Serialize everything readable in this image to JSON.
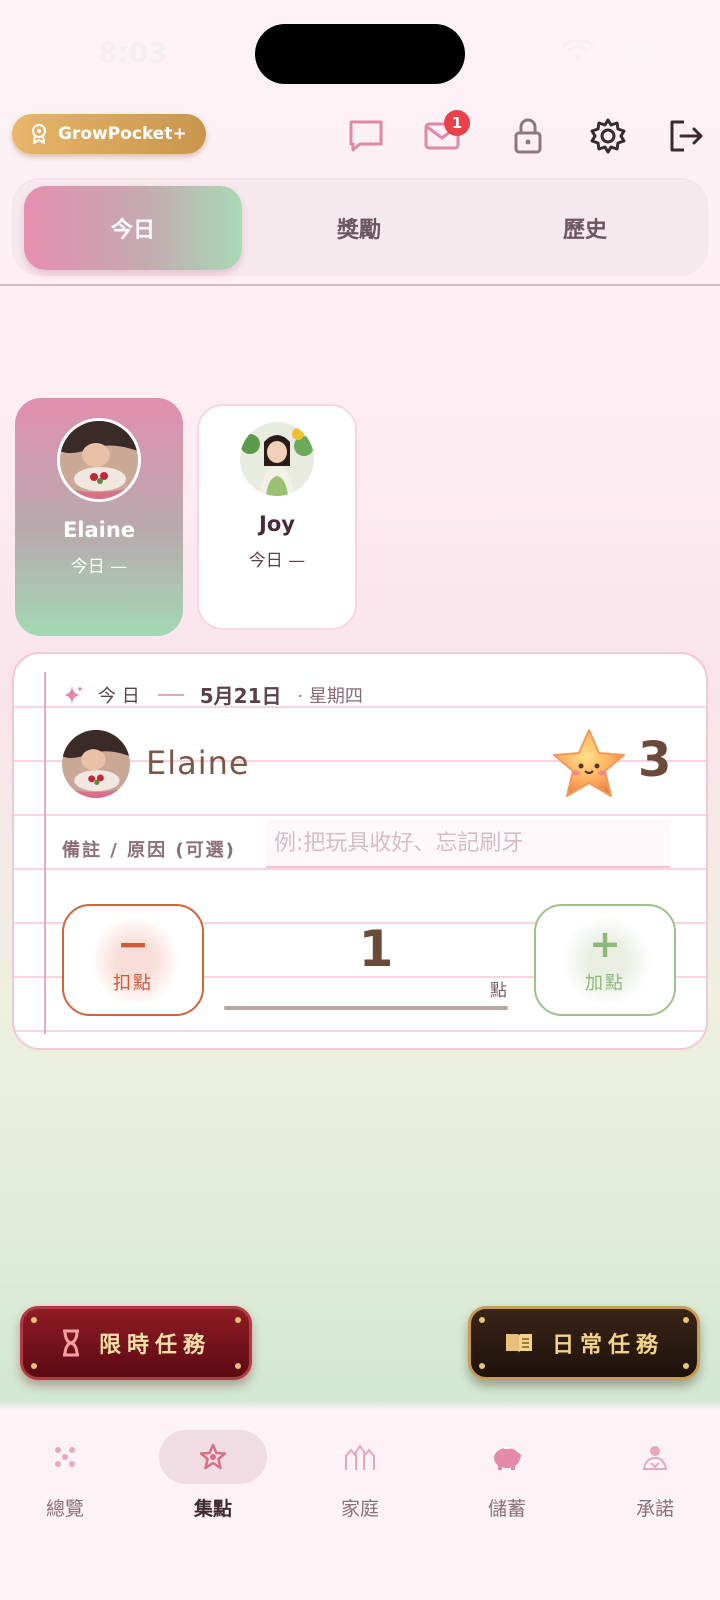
{
  "status_bar": {
    "time": "8:03"
  },
  "header": {
    "pro_badge_label": "GrowPocket+",
    "mail_badge_count": "1",
    "icons": [
      "chat-icon",
      "mail-icon",
      "lock-icon",
      "gear-icon",
      "logout-icon"
    ]
  },
  "tabs": [
    {
      "label": "今日",
      "active": true
    },
    {
      "label": "獎勵",
      "active": false
    },
    {
      "label": "歷史",
      "active": false
    }
  ],
  "kids": [
    {
      "name": "Elaine",
      "today": "今日 —",
      "selected": true
    },
    {
      "name": "Joy",
      "today": "今日 —",
      "selected": false
    }
  ],
  "entry": {
    "today_label": "今 日",
    "date": "5月21日",
    "weekday": "· 星期四",
    "kid_name": "Elaine",
    "star_count": "3",
    "reason_label": "備註 / 原因 (可選)",
    "reason_placeholder": "例:把玩具收好、忘記刷牙",
    "reason_value": "",
    "minus_label": "扣點",
    "plus_label": "加點",
    "amount": "1",
    "unit": "點"
  },
  "missions": {
    "timed_label": "限時任務",
    "daily_label": "日常任務"
  },
  "bottom_nav": [
    {
      "label": "總覽",
      "icon": "overview-icon",
      "active": false
    },
    {
      "label": "集點",
      "icon": "star-icon",
      "active": true
    },
    {
      "label": "家庭",
      "icon": "family-icon",
      "active": false
    },
    {
      "label": "儲蓄",
      "icon": "piggy-bank-icon",
      "active": false
    },
    {
      "label": "承諾",
      "icon": "promise-icon",
      "active": false
    }
  ],
  "colors": {
    "accent_pink": "#e68fb0",
    "accent_green": "#a8d9b5",
    "minus_red": "#cf5a3a",
    "plus_green": "#8db87a",
    "gold": "#e7b66a"
  }
}
